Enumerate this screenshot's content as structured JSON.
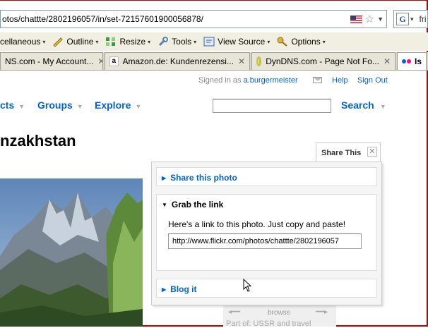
{
  "browser": {
    "url": "otos/chattte/2802196057/in/set-72157601900056878/",
    "search_partial": "fri",
    "toolbar": [
      {
        "label": "cellaneous",
        "icon": "none"
      },
      {
        "label": "Outline",
        "icon": "pencil-icon"
      },
      {
        "label": "Resize",
        "icon": "resize-icon"
      },
      {
        "label": "Tools",
        "icon": "wrench-icon"
      },
      {
        "label": "View Source",
        "icon": "source-icon"
      },
      {
        "label": "Options",
        "icon": "key-icon"
      }
    ],
    "tabs": [
      {
        "label": "NS.com - My Account...",
        "icon": "none"
      },
      {
        "label": "Amazon.de: Kundenrezensi...",
        "icon": "amazon-icon"
      },
      {
        "label": "DynDNS.com - Page Not Fo...",
        "icon": "dyndns-icon"
      },
      {
        "label": "Is",
        "icon": "flickr-icon"
      }
    ]
  },
  "header": {
    "signed_in_as": "Signed in as",
    "username": "a.burgermeister",
    "help": "Help",
    "sign_out": "Sign Out"
  },
  "nav": {
    "items": [
      "cts",
      "Groups",
      "Explore"
    ],
    "search_button": "Search"
  },
  "photo_title": "nzakhstan",
  "share": {
    "tab_label": "Share This",
    "close": "✕",
    "sections": {
      "share_photo": "Share this photo",
      "grab_link": "Grab the link",
      "grab_text": "Here's a link to this photo. Just copy and paste!",
      "link_value": "http://www.flickr.com/photos/chattte/2802196057",
      "blog_it": "Blog it"
    }
  },
  "browse_label": "browse",
  "part_of": "Part of: USSR and travel",
  "colors": {
    "link": "#0063dc",
    "border_red": "#c00000"
  }
}
